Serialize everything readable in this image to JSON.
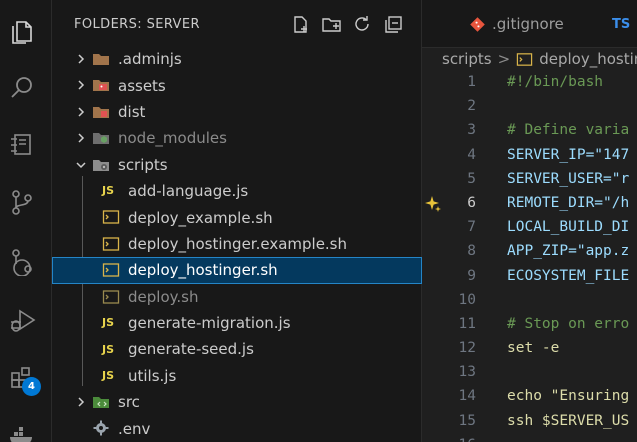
{
  "sidebar": {
    "title": "FOLDERS: SERVER",
    "items": [
      {
        "label": ".adminjs",
        "kind": "folder",
        "expanded": false,
        "dim": false
      },
      {
        "label": "assets",
        "kind": "folder",
        "expanded": false,
        "dim": false
      },
      {
        "label": "dist",
        "kind": "folder",
        "expanded": false,
        "dim": false
      },
      {
        "label": "node_modules",
        "kind": "folder",
        "expanded": false,
        "dim": true
      },
      {
        "label": "scripts",
        "kind": "folder",
        "expanded": true,
        "dim": false
      },
      {
        "label": "add-language.js",
        "kind": "js"
      },
      {
        "label": "deploy_example.sh",
        "kind": "sh"
      },
      {
        "label": "deploy_hostinger.example.sh",
        "kind": "sh"
      },
      {
        "label": "deploy_hostinger.sh",
        "kind": "sh",
        "selected": true
      },
      {
        "label": "deploy.sh",
        "kind": "sh",
        "dim": true
      },
      {
        "label": "generate-migration.js",
        "kind": "js"
      },
      {
        "label": "generate-seed.js",
        "kind": "js"
      },
      {
        "label": "utils.js",
        "kind": "js"
      },
      {
        "label": "src",
        "kind": "folder",
        "expanded": false
      },
      {
        "label": ".env",
        "kind": "gear"
      }
    ],
    "js_icon_text": "JS"
  },
  "activity_bar": {
    "icons": [
      "explorer-icon",
      "search-icon",
      "remote-explorer-icon",
      "source-control-icon",
      "git-graph-icon",
      "run-debug-icon",
      "extensions-icon",
      "docker-icon"
    ],
    "extensions_badge": "4"
  },
  "editor": {
    "tabs": [
      {
        "label": ".gitignore",
        "icon": "git-icon"
      },
      {
        "label": "TS",
        "icon": "ts-icon"
      }
    ],
    "breadcrumb": {
      "folder": "scripts",
      "sep": ">",
      "file": "deploy_hostin"
    },
    "lines": [
      {
        "n": "1",
        "text": "#!/bin/bash"
      },
      {
        "n": "2",
        "text": ""
      },
      {
        "n": "3",
        "text": "# Define varia"
      },
      {
        "n": "4",
        "text": "SERVER_IP=\"147"
      },
      {
        "n": "5",
        "text": "SERVER_USER=\"r"
      },
      {
        "n": "6",
        "text": "REMOTE_DIR=\"/h"
      },
      {
        "n": "7",
        "text": "LOCAL_BUILD_DI"
      },
      {
        "n": "8",
        "text": "APP_ZIP=\"app.z"
      },
      {
        "n": "9",
        "text": "ECOSYSTEM_FILE"
      },
      {
        "n": "10",
        "text": ""
      },
      {
        "n": "11",
        "text": "# Stop on erro"
      },
      {
        "n": "12",
        "text": "set -e"
      },
      {
        "n": "13",
        "text": ""
      },
      {
        "n": "14",
        "text": "echo \"Ensuring"
      },
      {
        "n": "15",
        "text": "ssh $SERVER_US"
      },
      {
        "n": "16",
        "text": ""
      }
    ],
    "active_line": "6"
  },
  "colors": {
    "background": "#181818",
    "editor_bg": "#1f1f1f",
    "selection": "#04395e",
    "selection_border": "#2485c7",
    "badge": "#0078d4",
    "js_yellow": "#e8d44d"
  }
}
